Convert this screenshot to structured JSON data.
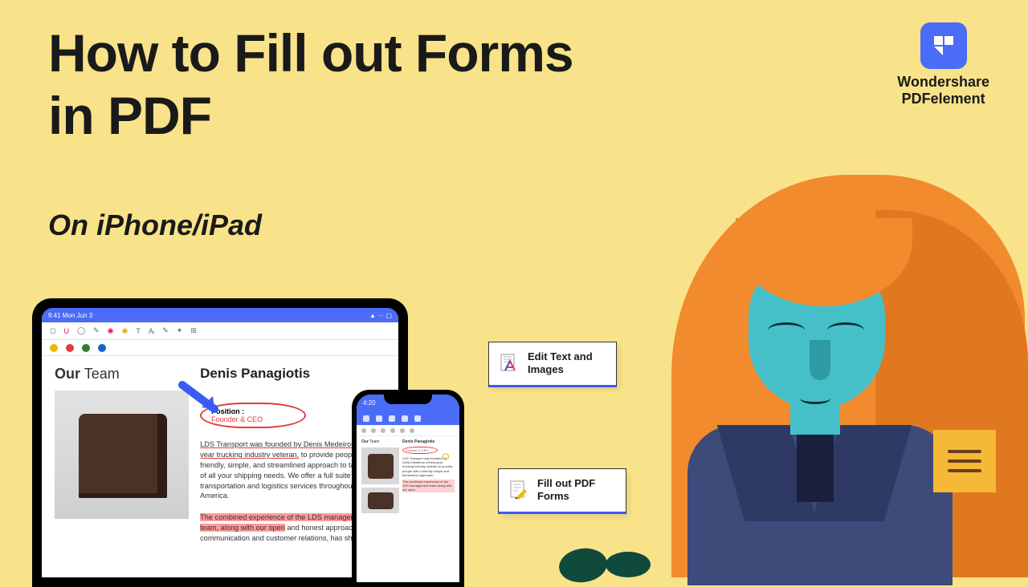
{
  "title_line1": "How to Fill out Forms",
  "title_line2": "in PDF",
  "subtitle": "On iPhone/iPad",
  "brand": {
    "line1": "Wondershare",
    "line2": "PDFelement"
  },
  "ipad": {
    "status_time": "9:41 Mon Jun 3",
    "our": "Our",
    "team": "Team",
    "name": "Denis Panagiotis",
    "position_label": "Position   :",
    "position_value": "Founder & CEO",
    "para_intro": "LDS Transport was founded by Denis Medeiros, a thirty-year trucking industry veteran,",
    "para_rest": " to provide people with a friendly, simple, and streamlined approach to taking care of all your shipping needs. We offer a full suite of transportation and logistics services throughout North America.",
    "para_hl": "The combined experience of the LDS management team, along with our open",
    "para_tail": " and honest approach to communication and customer relations, has shaped"
  },
  "iphone": {
    "time": "4:20",
    "our": "Our",
    "team": "Team",
    "name": "Denis Panagiotis",
    "pos": "Founder & CEO"
  },
  "card1": "Edit Text and\nImages",
  "card2": "Fill out PDF\nForms"
}
